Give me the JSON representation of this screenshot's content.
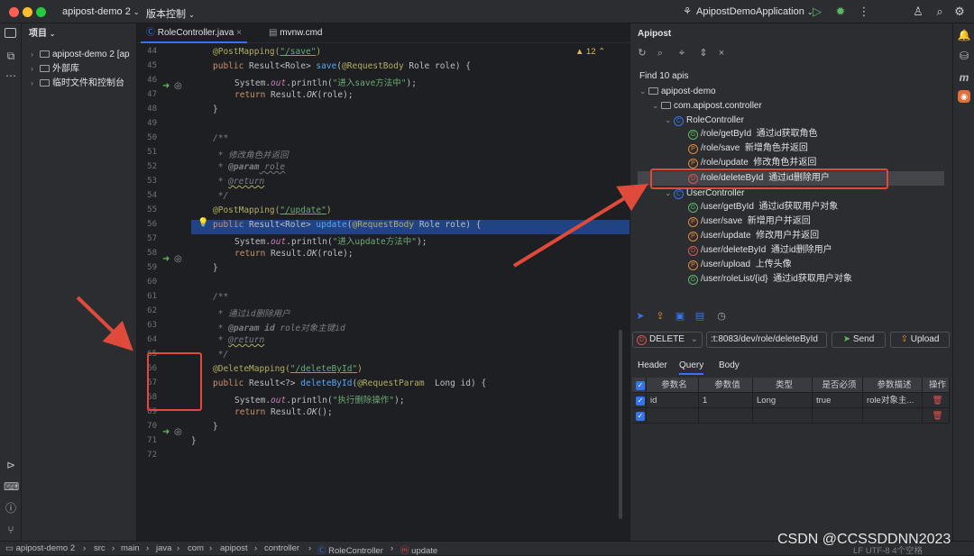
{
  "titlebar": {
    "project": "apipost-demo 2",
    "vcs": "版本控制",
    "run_config": "ApipostDemoApplication"
  },
  "project_panel": {
    "title": "项目",
    "items": [
      "apipost-demo 2 [ap",
      "外部库",
      "临时文件和控制台"
    ]
  },
  "editor": {
    "tabs": [
      "RoleController.java",
      "mvnw.cmd"
    ],
    "warning_count": "12",
    "line_numbers": [
      "44",
      "45",
      "46",
      "47",
      "48",
      "49",
      "50",
      "51",
      "52",
      "53",
      "54",
      "55",
      "56",
      "57",
      "58",
      "59",
      "60",
      "61",
      "62",
      "63",
      "64",
      "65",
      "66",
      "67",
      "68",
      "69",
      "70",
      "71",
      "72"
    ],
    "code": {
      "l44a": "@PostMapping(",
      "l44b": "\"/save\"",
      "l44c": ")",
      "l45a": "public ",
      "l45b": "Result<Role> ",
      "l45c": "save",
      "l45d": "(",
      "l45e": "@RequestBody",
      "l45f": " Role role) {",
      "l46a": "System.",
      "l46b": "out",
      "l46c": ".println(",
      "l46d": "\"进入save方法中\"",
      "l46e": ");",
      "l47a": "return ",
      "l47b": "Result.",
      "l47c": "OK",
      "l47d": "(role);",
      "l48": "}",
      "l50": "/**",
      "l51": " * 修改角色并返回",
      "l52a": " * ",
      "l52b": "@param",
      "l52c": " role",
      "l53a": " * ",
      "l53b": "@return",
      "l54": " */",
      "l55a": "@PostMapping(",
      "l55b": "\"/update\"",
      "l55c": ")",
      "l56a": "public ",
      "l56b": "Result<Role> ",
      "l56c": "update",
      "l56d": "(",
      "l56e": "@RequestBody",
      "l56f": " Role role) {",
      "l57a": "System.",
      "l57b": "out",
      "l57c": ".println(",
      "l57d": "\"进入update方法中\"",
      "l57e": ");",
      "l58a": "return ",
      "l58b": "Result.",
      "l58c": "OK",
      "l58d": "(role);",
      "l59": "}",
      "l61": "/**",
      "l62": " * 通过id删除用户",
      "l63a": " * ",
      "l63b": "@param",
      "l63c": " id ",
      "l63d": "role对象主键id",
      "l64a": " * ",
      "l64b": "@return",
      "l65": " */",
      "l66a": "@DeleteMapping(",
      "l66b": "\"/deleteById\"",
      "l66c": ")",
      "l67a": "public ",
      "l67b": "Result<?> ",
      "l67c": "deleteById",
      "l67d": "(",
      "l67e": "@RequestParam",
      "l67f": "  Long id) {",
      "l68a": "System.",
      "l68b": "out",
      "l68c": ".println(",
      "l68d": "\"执行删除操作\"",
      "l68e": ");",
      "l69a": "return ",
      "l69b": "Result.",
      "l69c": "OK",
      "l69d": "();",
      "l70": "}",
      "l71": "}"
    }
  },
  "apipost": {
    "title": "Apipost",
    "find_label": "Find 10 apis",
    "root": "apipost-demo",
    "package": "com.apipost.controller",
    "role_controller": "RoleController",
    "user_controller": "UserController",
    "role_apis": [
      {
        "method": "G",
        "path": "/role/getById",
        "desc": "通过id获取角色"
      },
      {
        "method": "P",
        "path": "/role/save",
        "desc": "新增角色并返回"
      },
      {
        "method": "P",
        "path": "/role/update",
        "desc": "修改角色并返回"
      },
      {
        "method": "D",
        "path": "/role/deleteById",
        "desc": "通过id删除用户"
      }
    ],
    "user_apis": [
      {
        "method": "G",
        "path": "/user/getById",
        "desc": "通过id获取用户对象"
      },
      {
        "method": "P",
        "path": "/user/save",
        "desc": "新增用户并返回"
      },
      {
        "method": "P",
        "path": "/user/update",
        "desc": "修改用户并返回"
      },
      {
        "method": "D",
        "path": "/user/deleteById",
        "desc": "通过id删除用户"
      },
      {
        "method": "P",
        "path": "/user/upload",
        "desc": "上传头像"
      },
      {
        "method": "G",
        "path": "/user/roleList/{id}",
        "desc": "通过id获取用户对象"
      }
    ],
    "request": {
      "method": "DELETE",
      "url": ":t:8083/dev/role/deleteById",
      "send": "Send",
      "upload": "Upload"
    },
    "tabs": [
      "Header",
      "Query",
      "Body"
    ],
    "active_tab": "Query",
    "table": {
      "headers": [
        "参数名",
        "参数值",
        "类型",
        "是否必须",
        "参数描述",
        "操作"
      ],
      "rows": [
        {
          "name": "id",
          "value": "1",
          "type": "Long",
          "required": "true",
          "desc": "role对象主..."
        }
      ]
    }
  },
  "status_bar": {
    "breadcrumb": [
      "apipost-demo 2",
      "src",
      "main",
      "java",
      "com",
      "apipost",
      "controller",
      "RoleController",
      "update"
    ],
    "right": "LF  UTF-8  4个空格"
  },
  "watermark": "CSDN @CCSSDDNN2023",
  "colors": {
    "accent": "#3574f0",
    "get": "#5fb865",
    "post": "#e08a3c",
    "delete": "#e05252",
    "annotation_red": "#e04a3a"
  }
}
